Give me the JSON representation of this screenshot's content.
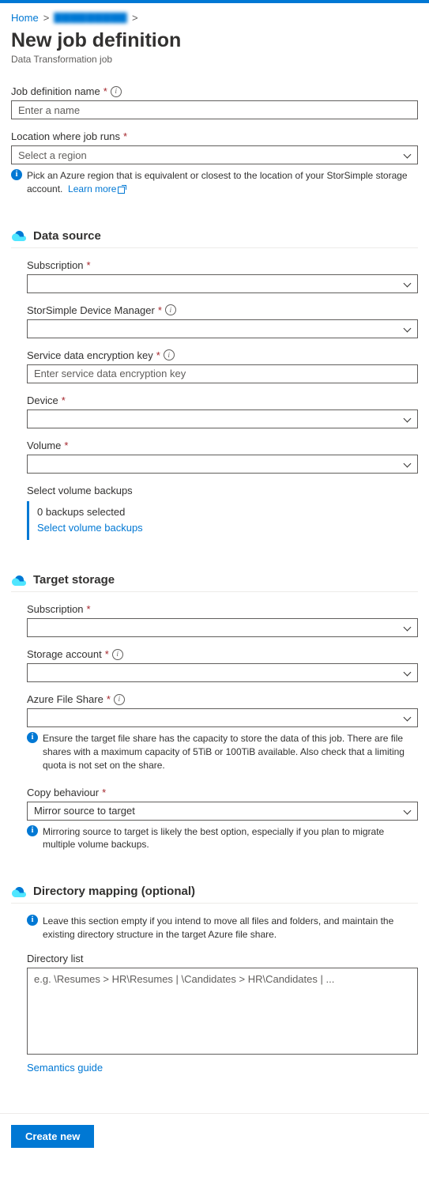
{
  "breadcrumb": {
    "home": "Home",
    "obscured": "▇▇▇▇▇▇▇▇▇"
  },
  "page": {
    "title": "New job definition",
    "subtitle": "Data Transformation job"
  },
  "fields": {
    "jobName": {
      "label": "Job definition name",
      "placeholder": "Enter a name"
    },
    "location": {
      "label": "Location where job runs",
      "placeholder": "Select a region",
      "info": "Pick an Azure region that is equivalent or closest to the location of your StorSimple storage account.",
      "learnMore": "Learn more"
    }
  },
  "dataSource": {
    "title": "Data source",
    "subscription": {
      "label": "Subscription"
    },
    "deviceManager": {
      "label": "StorSimple Device Manager"
    },
    "encryptionKey": {
      "label": "Service data encryption key",
      "placeholder": "Enter service data encryption key"
    },
    "device": {
      "label": "Device"
    },
    "volume": {
      "label": "Volume"
    },
    "backups": {
      "label": "Select volume backups",
      "status": "0 backups selected",
      "link": "Select volume backups"
    }
  },
  "targetStorage": {
    "title": "Target storage",
    "subscription": {
      "label": "Subscription"
    },
    "storageAccount": {
      "label": "Storage account"
    },
    "fileShare": {
      "label": "Azure File Share",
      "info": "Ensure the target file share has the capacity to store the data of this job. There are file shares with a maximum capacity of 5TiB or 100TiB available. Also check that a limiting quota is not set on the share."
    },
    "copyBehaviour": {
      "label": "Copy behaviour",
      "value": "Mirror source to target",
      "info": "Mirroring source to target is likely the best option, especially if you plan to migrate multiple volume backups."
    }
  },
  "directoryMapping": {
    "title": "Directory mapping (optional)",
    "info": "Leave this section empty if you intend to move all files and folders, and maintain the existing directory structure in the target Azure file share.",
    "listLabel": "Directory list",
    "placeholder": "e.g. \\Resumes > HR\\Resumes | \\Candidates > HR\\Candidates | ...",
    "semantics": "Semantics guide"
  },
  "footer": {
    "create": "Create new"
  }
}
